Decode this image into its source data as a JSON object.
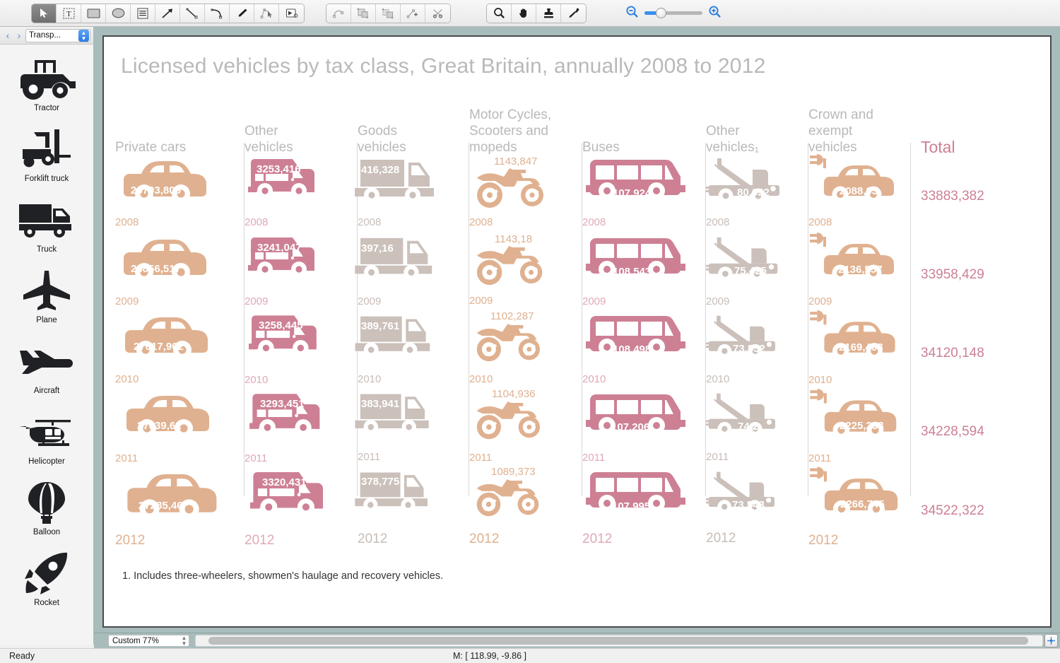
{
  "toolbar": {
    "tools": [
      {
        "name": "select-tool",
        "icon": "cursor-arrow-icon",
        "active": true
      },
      {
        "name": "text-tool",
        "icon": "text-box-icon",
        "active": false
      },
      {
        "name": "rectangle-tool",
        "icon": "rectangle-icon",
        "active": false
      },
      {
        "name": "ellipse-tool",
        "icon": "ellipse-icon",
        "active": false
      },
      {
        "name": "text-block-tool",
        "icon": "lines-box-icon",
        "active": false
      },
      {
        "name": "arrow-tool",
        "icon": "arrow-up-right-icon",
        "active": false
      },
      {
        "name": "line-tool",
        "icon": "line-segment-icon",
        "active": false
      },
      {
        "name": "curve-tool",
        "icon": "curve-icon",
        "active": false
      },
      {
        "name": "pen-tool",
        "icon": "pen-nib-icon",
        "active": false
      },
      {
        "name": "node-edit-tool",
        "icon": "node-edit-icon",
        "active": false
      },
      {
        "name": "callout-tool",
        "icon": "callout-box-icon",
        "active": false
      }
    ],
    "edit_tools": [
      {
        "name": "rotate-tool",
        "icon": "rotate-arc-icon"
      },
      {
        "name": "group-tool",
        "icon": "group-objects-icon"
      },
      {
        "name": "ungroup-tool",
        "icon": "ungroup-objects-icon"
      },
      {
        "name": "add-node-tool",
        "icon": "add-node-icon"
      },
      {
        "name": "cut-path-tool",
        "icon": "cut-path-icon"
      }
    ],
    "view_tools": [
      {
        "name": "zoom-tool",
        "icon": "magnifier-icon"
      },
      {
        "name": "hand-tool",
        "icon": "hand-icon"
      },
      {
        "name": "stamp-tool",
        "icon": "stamp-icon"
      },
      {
        "name": "eyedropper-tool",
        "icon": "eyedropper-icon"
      }
    ],
    "zoom_out_label": "zoom-out-icon",
    "zoom_in_label": "zoom-in-icon"
  },
  "library": {
    "selector_value": "Transp...",
    "prev_label": "‹",
    "next_label": "›",
    "items": [
      {
        "label": "Tractor",
        "icon": "tractor-icon"
      },
      {
        "label": "Forklift truck",
        "icon": "forklift-truck-icon"
      },
      {
        "label": "Truck",
        "icon": "truck-icon"
      },
      {
        "label": "Plane",
        "icon": "plane-top-icon"
      },
      {
        "label": "Aircraft",
        "icon": "aircraft-side-icon"
      },
      {
        "label": "Helicopter",
        "icon": "helicopter-icon"
      },
      {
        "label": "Balloon",
        "icon": "hot-air-balloon-icon"
      },
      {
        "label": "Rocket",
        "icon": "rocket-icon"
      }
    ]
  },
  "chart_data": {
    "type": "table",
    "title": "Licensed vehicles by tax class, Great Britain, annually 2008 to 2012",
    "footnote": "1. Includes three-wheelers, showmen's haulage and recovery vehicles.",
    "years": [
      "2008",
      "2009",
      "2010",
      "2011",
      "2012"
    ],
    "categories": [
      "Private cars",
      "Other vehicles",
      "Goods vehicles",
      "Motor Cycles, Scooters and mopeds",
      "Buses",
      "Other vehicles1",
      "Crown and exempt vehicles",
      "Total"
    ],
    "columns": [
      {
        "header": "Private cars",
        "header_lines": [
          "Private cars"
        ],
        "icon": "car-icon",
        "color": "#e0b190",
        "label_position": "inside",
        "values": [
          "26793,805",
          "26856,517",
          "27017,902",
          "27039,62",
          "27285,46"
        ]
      },
      {
        "header": "Other vehicles",
        "header_lines": [
          "Other",
          "vehicles"
        ],
        "icon": "minibus-icon",
        "color": "#cd8094",
        "label_position": "inside-top",
        "values": [
          "3253,416",
          "3241,047",
          "3258,445",
          "3293,451",
          "3320,431"
        ]
      },
      {
        "header": "Goods vehicles",
        "header_lines": [
          "Goods",
          "vehicles"
        ],
        "icon": "box-truck-icon",
        "color": "#cbc0ba",
        "label_position": "inside-top",
        "values": [
          "416,328",
          "397,16",
          "389,761",
          "383,941",
          "378,775"
        ]
      },
      {
        "header": "Motor Cycles, Scooters and mopeds",
        "header_lines": [
          "Motor Cycles,",
          "Scooters and",
          "mopeds"
        ],
        "icon": "motorcycle-icon",
        "color": "#e0b190",
        "label_position": "above",
        "values": [
          "1143,847",
          "1143,18",
          "1102,287",
          "1104,936",
          "1089,373"
        ]
      },
      {
        "header": "Buses",
        "header_lines": [
          "Buses"
        ],
        "icon": "bus-icon",
        "color": "#cd8094",
        "label_position": "inside",
        "values": [
          "107,924",
          "108,543",
          "108,498",
          "107,206",
          "107,995"
        ]
      },
      {
        "header": "Other vehicles1",
        "header_lines": [
          "Other",
          "vehicles₁"
        ],
        "icon": "tow-truck-icon",
        "color": "#cbc0ba",
        "label_position": "inside",
        "values": [
          "80,032",
          "75,425",
          "73,852",
          "74,2",
          "73,543"
        ]
      },
      {
        "header": "Crown and exempt vehicles",
        "header_lines": [
          "Crown and",
          "exempt",
          "vehicles"
        ],
        "icon": "electric-car-icon",
        "color": "#e0b190",
        "label_position": "inside",
        "values": [
          "2088,03",
          "2136,557",
          "2169,403",
          "2225,233",
          "2266,745"
        ]
      }
    ],
    "total": {
      "header": "Total",
      "color": "#cd8094",
      "values": [
        "33883,382",
        "33958,429",
        "34120,148",
        "34228,594",
        "34522,322"
      ]
    },
    "colors": {
      "title": "#b9b9b9",
      "header": "#b9b9b9",
      "peach": "#e0b190",
      "pink": "#cd8094",
      "grey": "#cbc0ba",
      "total": "#cd8094",
      "divider": "#d8d8d8"
    }
  },
  "statusbar": {
    "ready_label": "Ready",
    "coords_label": "M: [ 118.99, -9.86 ]"
  },
  "zoombar": {
    "zoom_value": "Custom 77%"
  }
}
